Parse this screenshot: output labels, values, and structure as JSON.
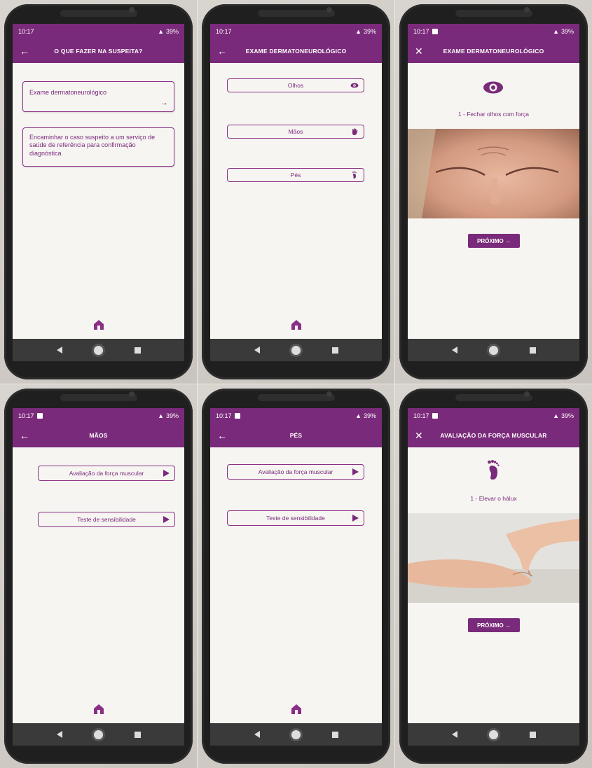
{
  "colors": {
    "brand": "#7a2a7a",
    "outline": "#8b2f86",
    "screen_bg": "#f6f5f2",
    "navbar": "#3a3a3a"
  },
  "status": {
    "time": "10:17",
    "battery": "39%"
  },
  "screens": [
    {
      "title": "O QUE FAZER NA SUSPEITA?",
      "nav_icon": "arrow-back-icon",
      "options": [
        {
          "label": "Exame dermatoneurológico",
          "icon": "arrow-forward-icon"
        },
        {
          "label": "Encaminhar o caso suspeito a um serviço de saúde de referência para confirmação diagnóstica"
        }
      ]
    },
    {
      "title": "EXAME DERMATONEUROLÓGICO",
      "nav_icon": "arrow-back-icon",
      "options": [
        {
          "label": "Olhos",
          "icon": "eye-icon"
        },
        {
          "label": "Mãos",
          "icon": "hand-icon"
        },
        {
          "label": "Pés",
          "icon": "foot-icon"
        }
      ]
    },
    {
      "title": "EXAME DERMATONEUROLÓGICO",
      "nav_icon": "close-icon",
      "exercise_icon": "eye-icon",
      "caption": "1 - Fechar olhos com força",
      "next_label": "PRÓXIMO →"
    },
    {
      "title": "MÃOS",
      "nav_icon": "arrow-back-icon",
      "options": [
        {
          "label": "Avaliação da força muscular",
          "icon": "play-icon"
        },
        {
          "label": "Teste de sensibilidade",
          "icon": "play-icon"
        }
      ]
    },
    {
      "title": "PÉS",
      "nav_icon": "arrow-back-icon",
      "options": [
        {
          "label": "Avaliação da força muscular",
          "icon": "play-icon"
        },
        {
          "label": "Teste de sensibilidade",
          "icon": "play-icon"
        }
      ]
    },
    {
      "title": "AVALIAÇÃO DA FORÇA MUSCULAR",
      "nav_icon": "close-icon",
      "exercise_icon": "foot-icon",
      "caption": "1 - Elevar o hálux",
      "next_label": "PRÓXIMO →"
    }
  ]
}
